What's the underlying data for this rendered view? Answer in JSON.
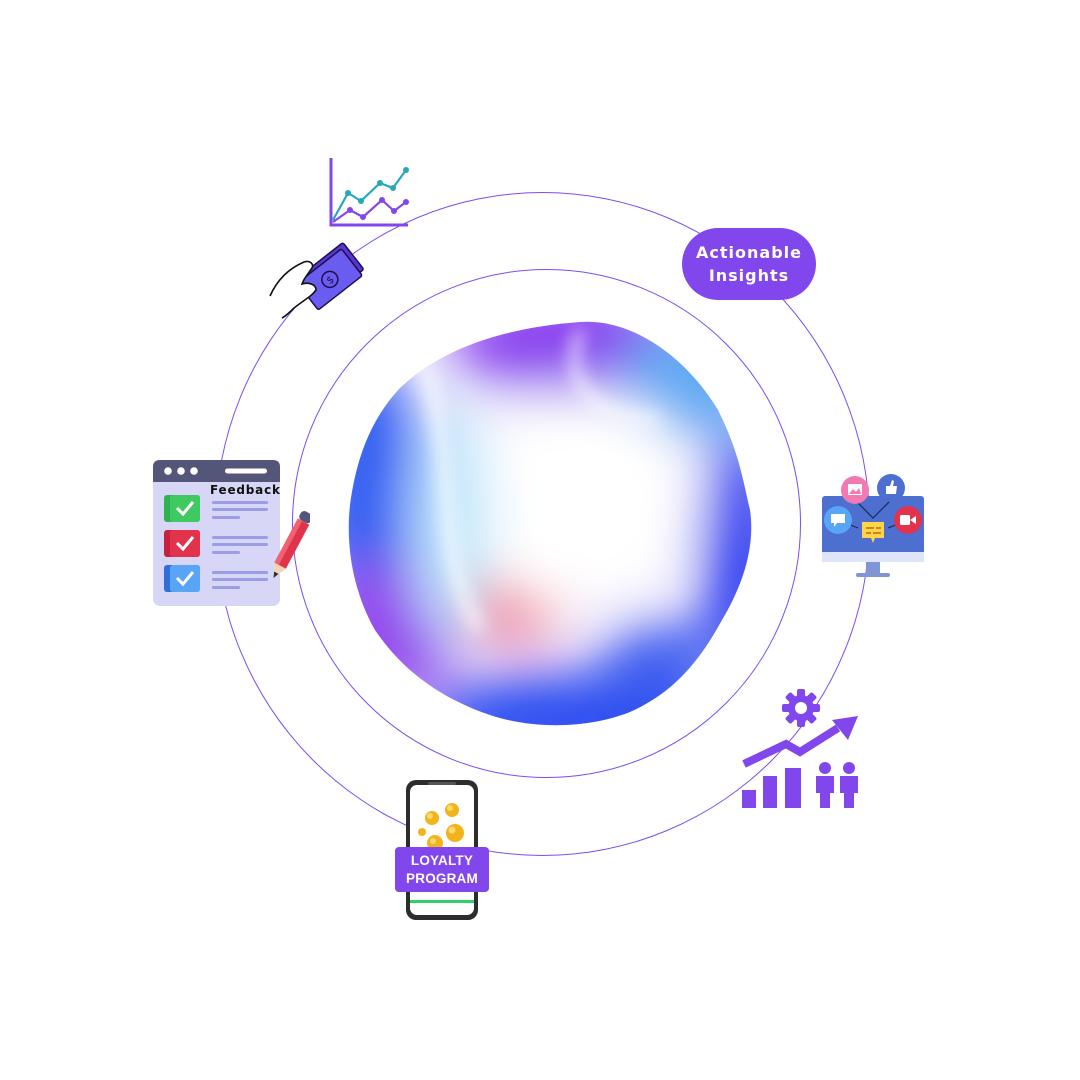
{
  "labels": {
    "actionable_insights": "Actionable Insights",
    "feedback": "Feedback",
    "loyalty_program": "LOYALTY PROGRAM"
  },
  "colors": {
    "accent": "#8247ec",
    "ring": "#7c4df2",
    "check_green": "#2fb24f",
    "check_red": "#e2334c",
    "check_blue": "#3d8ff0"
  },
  "icons": [
    "line-chart-icon",
    "hand-money-icon",
    "feedback-checklist-icon",
    "social-monitor-icon",
    "growth-analytics-icon",
    "loyalty-phone-icon"
  ]
}
